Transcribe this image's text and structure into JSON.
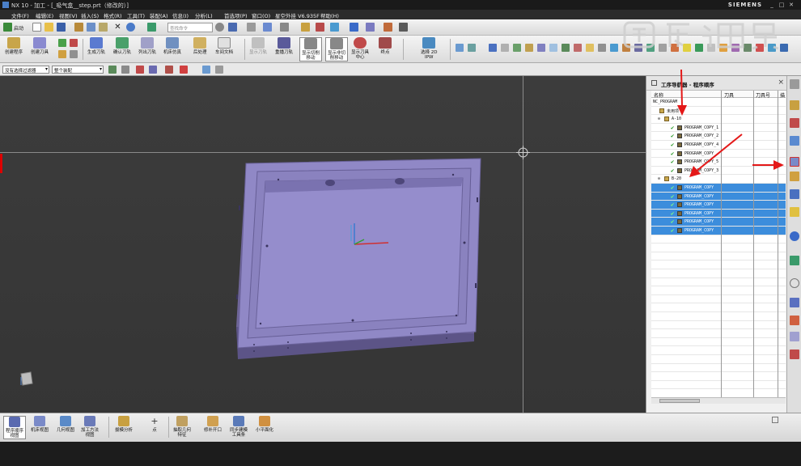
{
  "window": {
    "title": "NX 10 - 加工 - [_吸气盒__step.prt（修改的）]",
    "brand": "SIEMENS"
  },
  "menu": [
    "文件(F)",
    "编辑(E)",
    "视图(V)",
    "插入(S)",
    "格式(R)",
    "工具(T)",
    "装配(A)",
    "信息(I)",
    "分析(L)",
    "首选项(P)",
    "窗口(O)",
    "星空外挂 V6.935F",
    "帮助(H)"
  ],
  "quickbar": {
    "start_label": "启动",
    "search_placeholder": "查找命令"
  },
  "ribbon": {
    "create_program": "创建程序",
    "create_tool": "创建刀具",
    "generate_path": "生成刀轨",
    "verify_path": "确认刀轨",
    "list_path": "列出刀轨",
    "machine_sim": "机床仿真",
    "postprocess": "后处理",
    "shop_doc": "车间文档",
    "show_path": "显示刀轨",
    "replay_path": "重播刀轨",
    "show_cut_move_1": "显示切削",
    "show_cut_move_2": "移动",
    "show_noncut_move_1": "显示非切",
    "show_noncut_move_2": "削移动",
    "show_tool_center_1": "显示刀具",
    "show_tool_center_2": "中心",
    "end_point": "终点",
    "select_2d_ipw_1": "选择 2D",
    "select_2d_ipw_2": "IPW"
  },
  "filterbar": {
    "type_filter": "没有选择过滤器",
    "scope": "整个装配"
  },
  "navigator": {
    "title": "工序导航器 - 程序顺序",
    "columns": [
      "名称",
      "刀具",
      "刀具号",
      "描"
    ],
    "rows": [
      {
        "label": "NC_PROGRAM",
        "indent": 0,
        "type": "root",
        "selected": false
      },
      {
        "label": "未用项",
        "indent": 1,
        "type": "folder",
        "selected": false
      },
      {
        "label": "A-10",
        "indent": 1,
        "type": "group",
        "selected": false
      },
      {
        "label": "PROGRAM_COPY_1",
        "indent": 2,
        "type": "op",
        "selected": false
      },
      {
        "label": "PROGRAM_COPY_2",
        "indent": 2,
        "type": "op",
        "selected": false
      },
      {
        "label": "PROGRAM_COPY_4",
        "indent": 2,
        "type": "op",
        "selected": false
      },
      {
        "label": "PROGRAM_COPY",
        "indent": 2,
        "type": "op",
        "selected": false
      },
      {
        "label": "PROGRAM_COPY_5",
        "indent": 2,
        "type": "op",
        "selected": false
      },
      {
        "label": "PROGRAM_COPY_3",
        "indent": 2,
        "type": "op",
        "selected": false
      },
      {
        "label": "B-20",
        "indent": 1,
        "type": "group",
        "selected": false
      },
      {
        "label": "PROGRAM_COPY",
        "indent": 2,
        "type": "op",
        "selected": true
      },
      {
        "label": "PROGRAM_COPY",
        "indent": 2,
        "type": "op",
        "selected": true
      },
      {
        "label": "PROGRAM_COPY",
        "indent": 2,
        "type": "op",
        "selected": true
      },
      {
        "label": "PROGRAM_COPY",
        "indent": 2,
        "type": "op",
        "selected": true
      },
      {
        "label": "PROGRAM_COPY",
        "indent": 2,
        "type": "op",
        "selected": true
      },
      {
        "label": "PROGRAM_COPY",
        "indent": 2,
        "type": "op",
        "selected": true
      }
    ]
  },
  "bottombar": {
    "program_order_view_1": "程序顺序",
    "program_order_view_2": "视图",
    "machine_view": "机床视图",
    "geometry_view": "几何视图",
    "method_view_1": "加工方法",
    "method_view_2": "视图",
    "draft_analysis": "拔模分析",
    "point": "点",
    "extract_geometry_1": "抽取几何",
    "extract_geometry_2": "特征",
    "patch_opening": "修补开口",
    "sync_modeling_1": "同步建模",
    "sync_modeling_2": "工具条",
    "small_surface": "小平面化"
  },
  "colors": {
    "part": "#8f85c4",
    "selection": "#3c8ddc",
    "annotation_arrow": "#e41818",
    "viewport_bg": "#3a3a3a"
  },
  "watermark": {
    "text": "虎课网"
  }
}
